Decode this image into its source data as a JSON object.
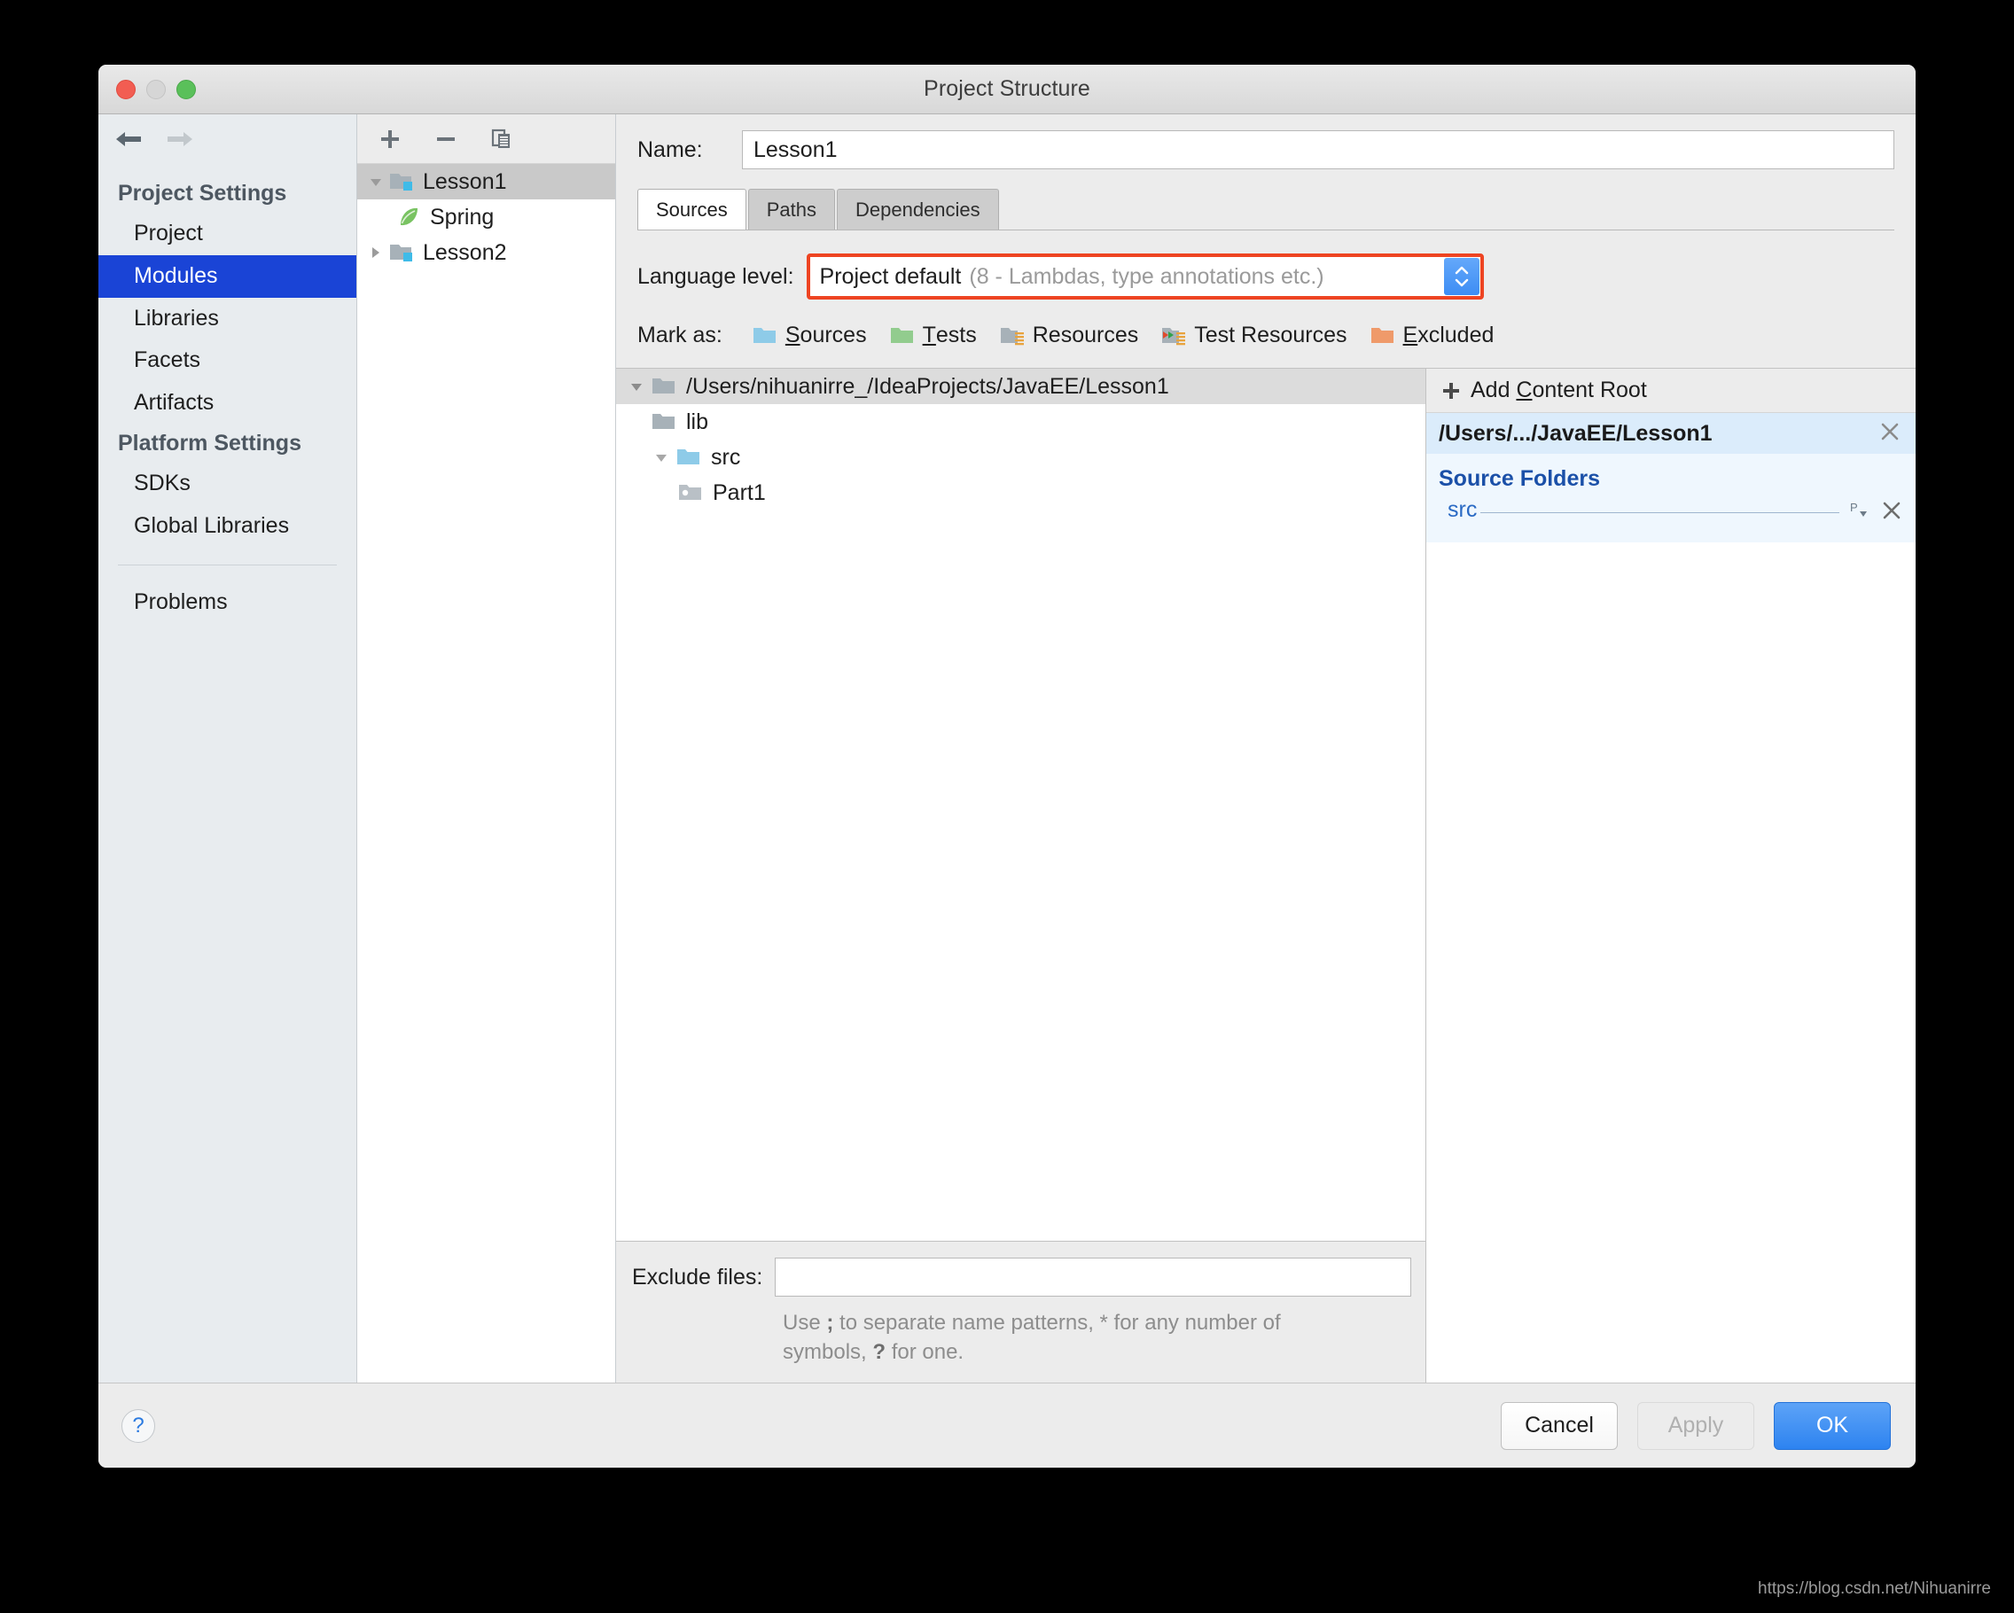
{
  "window": {
    "title": "Project Structure",
    "traffic_lights": [
      "close",
      "minimize",
      "zoom"
    ]
  },
  "nav": {
    "back": "back-arrow",
    "forward": "forward-arrow"
  },
  "sidebar": {
    "groups": [
      {
        "label": "Project Settings",
        "items": [
          {
            "label": "Project",
            "selected": false
          },
          {
            "label": "Modules",
            "selected": true
          },
          {
            "label": "Libraries",
            "selected": false
          },
          {
            "label": "Facets",
            "selected": false
          },
          {
            "label": "Artifacts",
            "selected": false
          }
        ]
      },
      {
        "label": "Platform Settings",
        "items": [
          {
            "label": "SDKs",
            "selected": false
          },
          {
            "label": "Global Libraries",
            "selected": false
          }
        ]
      }
    ],
    "extra_items": [
      {
        "label": "Problems"
      }
    ],
    "selected_color": "#1a44d6"
  },
  "modules_panel": {
    "toolbar": [
      {
        "icon": "plus-icon",
        "label": "Add"
      },
      {
        "icon": "minus-icon",
        "label": "Remove"
      },
      {
        "icon": "copy-icon",
        "label": "Copy"
      }
    ],
    "tree": [
      {
        "label": "Lesson1",
        "icon": "module-folder-icon",
        "expanded": true,
        "selected": true,
        "level": 0
      },
      {
        "label": "Spring",
        "icon": "spring-leaf-icon",
        "expanded": null,
        "selected": false,
        "level": 1
      },
      {
        "label": "Lesson2",
        "icon": "module-folder-icon",
        "expanded": false,
        "selected": false,
        "level": 0
      }
    ]
  },
  "main": {
    "name": {
      "label": "Name:",
      "value": "Lesson1",
      "placeholder": ""
    },
    "tabs": [
      {
        "label": "Sources",
        "active": true
      },
      {
        "label": "Paths",
        "active": false
      },
      {
        "label": "Dependencies",
        "active": false
      }
    ],
    "language_level": {
      "label": "Language level:",
      "value_primary": "Project default",
      "value_secondary": "(8 - Lambdas, type annotations etc.)",
      "highlight_color": "#ee4422",
      "stepper_color": "#3d8df4"
    },
    "mark_as": {
      "label": "Mark as:",
      "options": [
        {
          "label": "Sources",
          "mnemonic": "S",
          "icon": "folder-blue-icon",
          "color": "#8ecbe8"
        },
        {
          "label": "Tests",
          "mnemonic": "T",
          "icon": "folder-green-icon",
          "color": "#92cc8e"
        },
        {
          "label": "Resources",
          "mnemonic": "R",
          "icon": "folder-resources-icon",
          "color": "#a7b1b8"
        },
        {
          "label": "Test Resources",
          "mnemonic": "",
          "icon": "folder-test-resources-icon",
          "color": "#a7b1b8"
        },
        {
          "label": "Excluded",
          "mnemonic": "E",
          "icon": "folder-orange-icon",
          "color": "#ef9a6a"
        }
      ]
    },
    "content_tree": [
      {
        "label": "/Users/nihuanirre_/IdeaProjects/JavaEE/Lesson1",
        "icon": "folder-gray-icon",
        "level": 0,
        "expanded": true,
        "selected": true
      },
      {
        "label": "lib",
        "icon": "folder-gray-icon",
        "level": 1,
        "expanded": null,
        "selected": false
      },
      {
        "label": "src",
        "icon": "folder-blue-icon",
        "level": 1,
        "expanded": true,
        "selected": false
      },
      {
        "label": "Part1",
        "icon": "package-icon",
        "level": 2,
        "expanded": null,
        "selected": false
      }
    ],
    "exclude": {
      "label": "Exclude files:",
      "value": "",
      "placeholder": "",
      "hint_prefix": "Use ",
      "hint_semicolon": ";",
      "hint_mid": " to separate name patterns, * for any number of symbols, ",
      "hint_question": "?",
      "hint_suffix": " for one.",
      "hint_full": "Use ; to separate name patterns, * for any number of symbols, ? for one."
    },
    "roots_panel": {
      "add_content_root": "Add Content Root",
      "add_content_root_mnemonic": "C",
      "content_root_path": "/Users/.../JavaEE/Lesson1",
      "source_folders_title": "Source Folders",
      "source_folders": [
        {
          "name": "src",
          "package_prefix_icon": "package-prefix-icon",
          "remove_icon": "close-icon"
        }
      ],
      "remove_root_icon": "close-icon"
    }
  },
  "footer": {
    "help": "?",
    "buttons": [
      {
        "label": "Cancel",
        "style": "normal"
      },
      {
        "label": "Apply",
        "style": "disabled"
      },
      {
        "label": "OK",
        "style": "primary"
      }
    ]
  },
  "watermark": "https://blog.csdn.net/Nihuanirre"
}
